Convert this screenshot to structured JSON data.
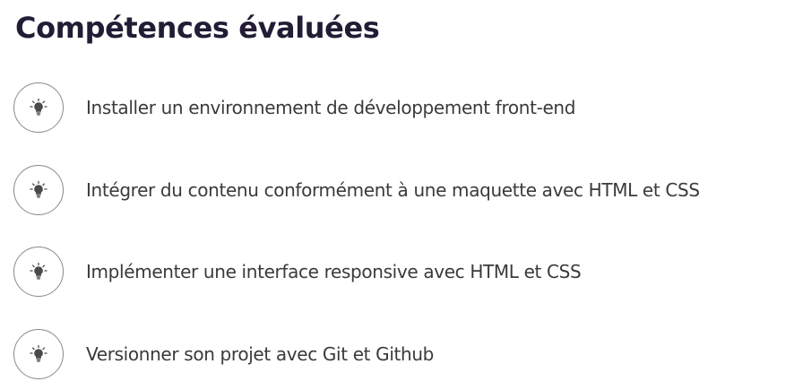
{
  "section": {
    "title": "Compétences évaluées",
    "skills": [
      {
        "label": "Installer un environnement de développement front-end",
        "icon": "lightbulb-icon"
      },
      {
        "label": "Intégrer du contenu conformément à une maquette avec HTML et CSS",
        "icon": "lightbulb-icon"
      },
      {
        "label": "Implémenter une interface responsive avec HTML et CSS",
        "icon": "lightbulb-icon"
      },
      {
        "label": "Versionner son projet avec Git et Github",
        "icon": "lightbulb-icon"
      }
    ]
  },
  "colors": {
    "heading": "#221c35",
    "text": "#3a3a3a",
    "icon_border": "#8a8a8a",
    "icon_fill": "#4a4a4a"
  }
}
